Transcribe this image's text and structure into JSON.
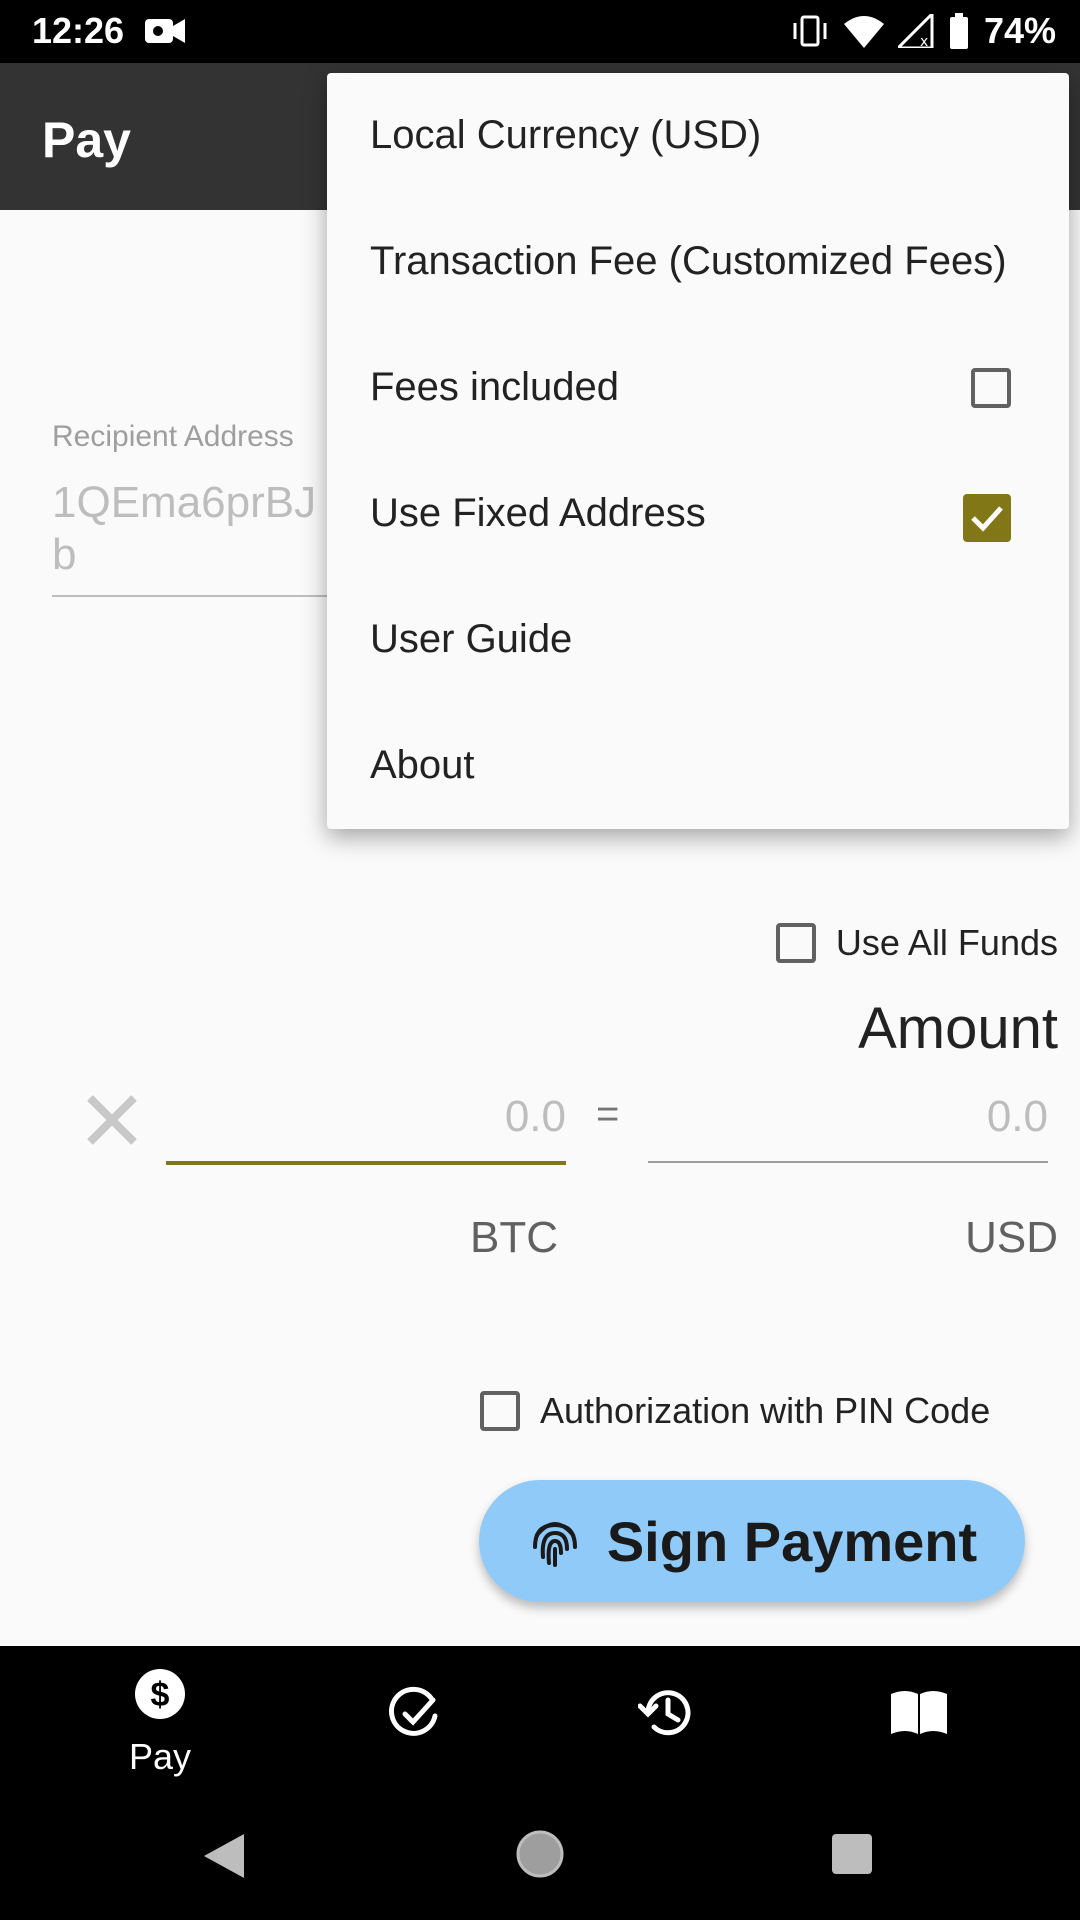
{
  "status_bar": {
    "time": "12:26",
    "battery": "74%"
  },
  "app_bar": {
    "title": "Pay"
  },
  "recipient": {
    "label": "Recipient Address",
    "value": "1QEma6prBJ\nb"
  },
  "use_all_funds": {
    "label": "Use All Funds",
    "checked": false
  },
  "amount": {
    "title": "Amount",
    "btc_placeholder": "0.0",
    "usd_placeholder": "0.0",
    "equals": "=",
    "btc_unit": "BTC",
    "usd_unit": "USD"
  },
  "auth_pin": {
    "label": "Authorization with PIN Code",
    "checked": false
  },
  "sign_button": {
    "label": "Sign Payment"
  },
  "bottom_nav": {
    "pay_label": "Pay"
  },
  "menu": {
    "items": [
      {
        "label": "Local Currency (USD)"
      },
      {
        "label": "Transaction Fee (Customized Fees)"
      },
      {
        "label": "Fees included",
        "checked": false
      },
      {
        "label": "Use Fixed Address",
        "checked": true
      },
      {
        "label": "User Guide"
      },
      {
        "label": "About"
      }
    ]
  },
  "colors": {
    "accent": "#827717",
    "button": "#90caf9",
    "app_bar": "#333333"
  }
}
